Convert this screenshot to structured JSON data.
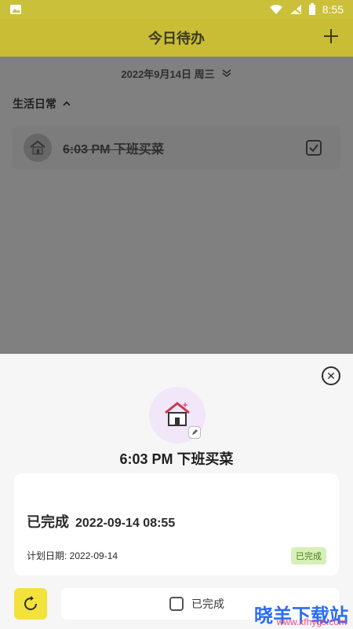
{
  "status_bar": {
    "time": "8:55",
    "icons": [
      "image-icon",
      "wifi-icon",
      "signal-off-icon",
      "battery-icon"
    ]
  },
  "header": {
    "title": "今日待办",
    "add_icon": "plus-icon"
  },
  "date_selector": {
    "text": "2022年9月14日 周三",
    "icon": "double-chevron-down-icon"
  },
  "section": {
    "title": "生活日常",
    "icon": "chevron-up-icon"
  },
  "task": {
    "title": "6:03 PM 下班买菜",
    "icon": "house-icon",
    "checked": true
  },
  "sheet": {
    "title": "6:03 PM 下班买菜",
    "done_label": "已完成",
    "done_time": "2022-09-14 08:55",
    "plan_label": "计划日期: 2022-09-14",
    "status_pill": "已完成",
    "bottom_button_label": "已完成"
  },
  "watermark": {
    "main": "晓羊下载站",
    "sub": "www.xfhygs.com"
  },
  "colors": {
    "accent": "#c8bd35",
    "dim": "#808080",
    "pill_bg": "#d7f0b8",
    "pill_text": "#4a7f1a",
    "reset_btn": "#f2e23b"
  }
}
